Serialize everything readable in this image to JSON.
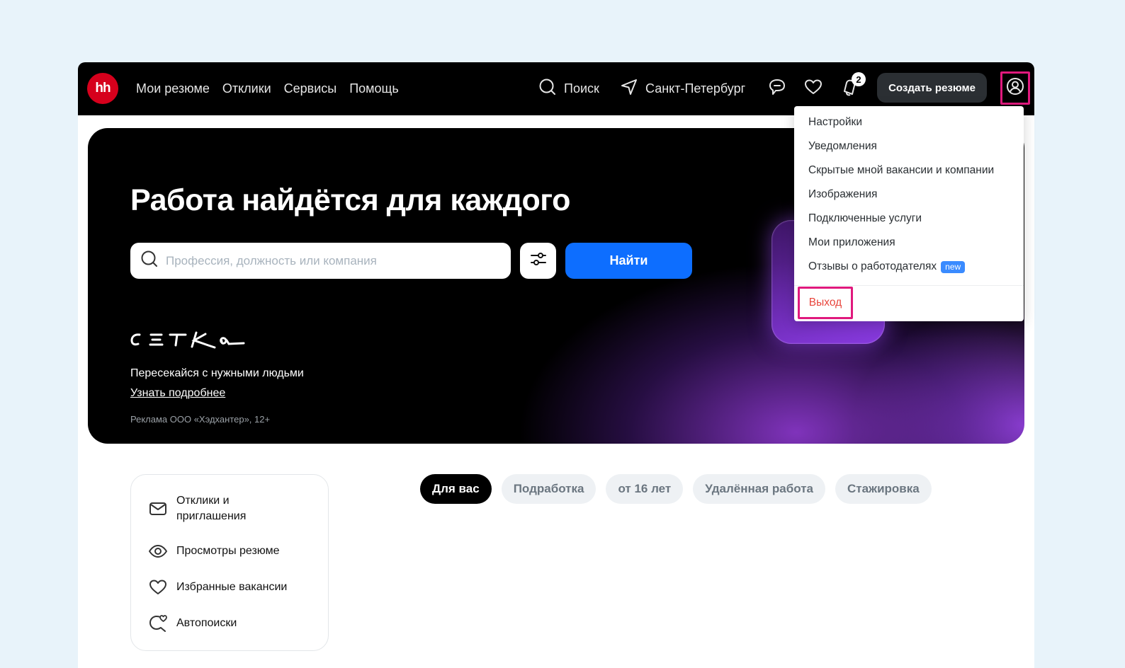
{
  "header": {
    "logo_text": "hh",
    "nav": [
      "Мои резюме",
      "Отклики",
      "Сервисы",
      "Помощь"
    ],
    "search_label": "Поиск",
    "city_label": "Санкт-Петербург",
    "notifications_count": "2",
    "create_resume_label": "Создать резюме"
  },
  "hero": {
    "title": "Работа найдётся для каждого",
    "search_placeholder": "Профессия, должность или компания",
    "find_label": "Найти",
    "promo_text": "Пересекайся с нужными людьми",
    "promo_link": "Узнать подробнее",
    "disclaimer": "Реклама ООО «Хэдхантер», 12+"
  },
  "sidebar": {
    "items": [
      {
        "label_line1": "Отклики и",
        "label_line2": "приглашения",
        "icon": "envelope-icon"
      },
      {
        "label": "Просмотры резюме",
        "icon": "eye-icon"
      },
      {
        "label": "Избранные вакансии",
        "icon": "heart-icon"
      },
      {
        "label": "Автопоиски",
        "icon": "autosearch-icon"
      }
    ]
  },
  "tabs": [
    "Для вас",
    "Подработка",
    "от 16 лет",
    "Удалённая работа",
    "Стажировка"
  ],
  "menu": {
    "items": [
      "Настройки",
      "Уведомления",
      "Скрытые мной вакансии и компании",
      "Изображения",
      "Подключенные услуги",
      "Мои приложения",
      "Отзывы о работодателях"
    ],
    "new_badge": "new",
    "logout": "Выход"
  },
  "colors": {
    "brand_red": "#d6001c",
    "primary_blue": "#0d6eff",
    "highlight_pink": "#e0197d",
    "logout_red": "#e8453c"
  }
}
